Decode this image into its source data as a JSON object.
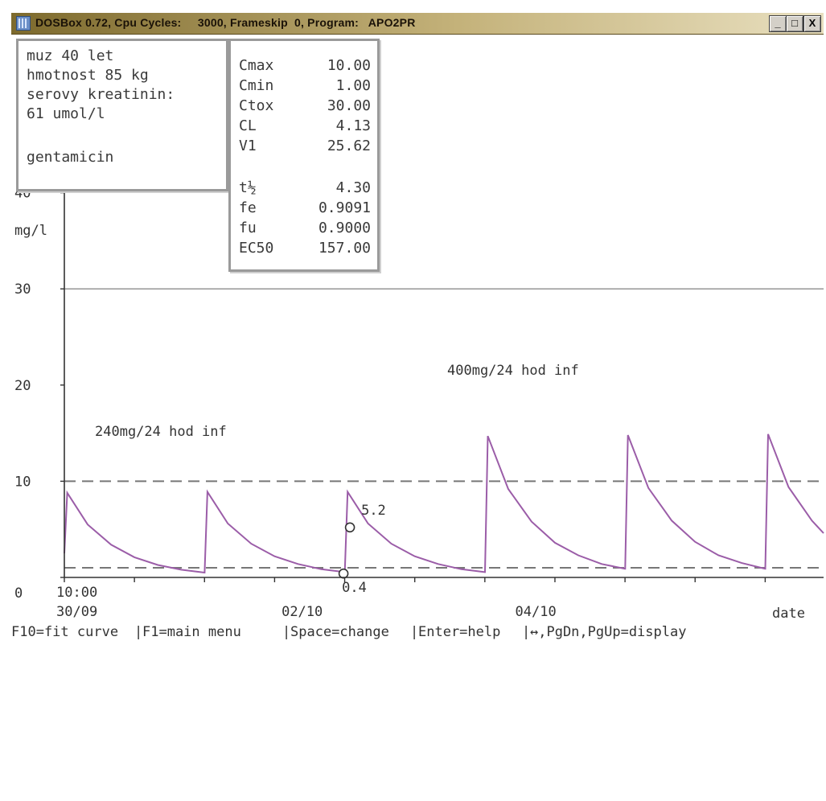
{
  "window": {
    "title": "DOSBox 0.72, Cpu Cycles:     3000, Frameskip  0, Program:   APO2PR",
    "buttons": {
      "minimize": "_",
      "maximize": "□",
      "close": "X"
    }
  },
  "patient": {
    "lines": [
      "muz 40 let",
      "hmotnost 85 kg",
      "serovy kreatinin:",
      "61 umol/l",
      "",
      "gentamicin"
    ]
  },
  "parameters": {
    "group1": [
      {
        "name": "Cmax",
        "value": "10.00"
      },
      {
        "name": "Cmin",
        "value": "1.00"
      },
      {
        "name": "Ctox",
        "value": "30.00"
      },
      {
        "name": "CL",
        "value": "4.13"
      },
      {
        "name": "V1",
        "value": "25.62"
      }
    ],
    "group2": [
      {
        "name": "t½",
        "value": "4.30"
      },
      {
        "name": "fe",
        "value": "0.9091"
      },
      {
        "name": "fu",
        "value": "0.9000"
      },
      {
        "name": "EC50",
        "value": "157.00"
      }
    ]
  },
  "chart_data": {
    "type": "line",
    "ylabel": "mg/l",
    "y_tick_labels": [
      "0",
      "10",
      "20",
      "30",
      "40"
    ],
    "ylim": [
      0,
      50
    ],
    "x_tick_labels": [
      {
        "time": "10:00",
        "date": "30/09"
      },
      {
        "time": "",
        "date": "02/10"
      },
      {
        "time": "",
        "date": "04/10"
      }
    ],
    "x_axis_label": "date",
    "x_unit": "hours from 30/09 10:00",
    "xlim": [
      0,
      130
    ],
    "reference_lines": {
      "Cmax": 10,
      "Cmin": 1,
      "Ctox": 30
    },
    "regimens": [
      {
        "label": "240mg/24 hod inf"
      },
      {
        "label": "400mg/24 hod inf"
      }
    ],
    "series": [
      {
        "values": [
          [
            0,
            2.5
          ],
          [
            0.5,
            8.8
          ],
          [
            4,
            5.5
          ],
          [
            8,
            3.4
          ],
          [
            12,
            2.1
          ],
          [
            16,
            1.3
          ],
          [
            20,
            0.8
          ],
          [
            24,
            0.5
          ],
          [
            24.02,
            0.5
          ],
          [
            24.5,
            8.9
          ],
          [
            28,
            5.6
          ],
          [
            32,
            3.5
          ],
          [
            36,
            2.2
          ],
          [
            40,
            1.4
          ],
          [
            44,
            0.85
          ],
          [
            48,
            0.55
          ],
          [
            48.02,
            0.55
          ],
          [
            48.5,
            8.9
          ],
          [
            52,
            5.6
          ],
          [
            56,
            3.5
          ],
          [
            60,
            2.2
          ],
          [
            64,
            1.4
          ],
          [
            68,
            0.85
          ],
          [
            72,
            0.55
          ],
          [
            72.02,
            0.55
          ],
          [
            72.5,
            14.7
          ],
          [
            76,
            9.2
          ],
          [
            80,
            5.8
          ],
          [
            84,
            3.6
          ],
          [
            88,
            2.3
          ],
          [
            92,
            1.4
          ],
          [
            96,
            0.9
          ],
          [
            96.02,
            0.9
          ],
          [
            96.5,
            14.8
          ],
          [
            100,
            9.3
          ],
          [
            104,
            5.9
          ],
          [
            108,
            3.7
          ],
          [
            112,
            2.3
          ],
          [
            116,
            1.5
          ],
          [
            120,
            0.9
          ],
          [
            120.02,
            0.9
          ],
          [
            120.5,
            14.9
          ],
          [
            124,
            9.4
          ],
          [
            128,
            5.9
          ],
          [
            130,
            4.6
          ]
        ]
      }
    ],
    "measured_points": [
      {
        "x": 48.9,
        "y": 5.2,
        "label": "5.2"
      },
      {
        "x": 47.8,
        "y": 0.4,
        "label": "0.4"
      }
    ],
    "colors": {
      "curve": "#9b5da8",
      "grid": "#8c8c8c",
      "axes": "#333333"
    }
  },
  "statusbar": {
    "f10": "F10=fit curve",
    "f1": "F1=main menu",
    "space": "Space=change",
    "enter": "Enter=help",
    "arrows": "↔,PgDn,PgUp=display",
    "separator": "|"
  }
}
